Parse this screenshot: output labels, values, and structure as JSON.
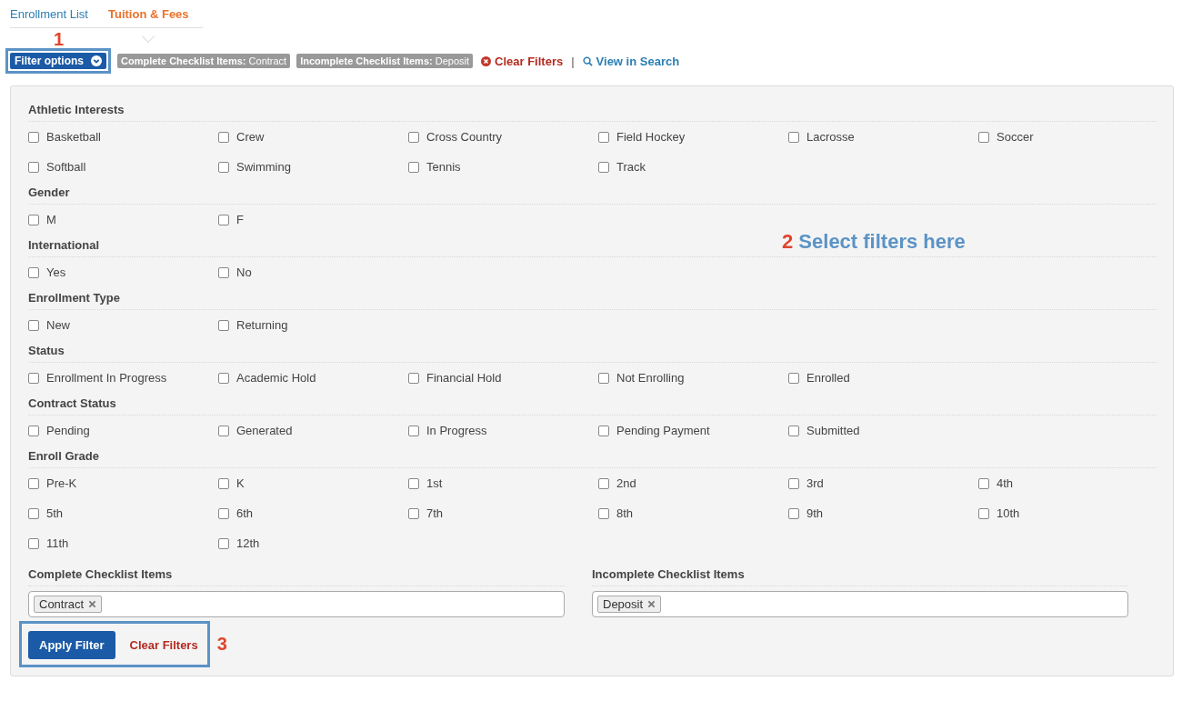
{
  "tabs": [
    {
      "label": "Enrollment List",
      "selected": false
    },
    {
      "label": "Tuition & Fees",
      "selected": true
    }
  ],
  "toolbar": {
    "callout": "1",
    "filter_button": "Filter options",
    "chips": [
      {
        "label": "Complete Checklist Items:",
        "value": "Contract"
      },
      {
        "label": "Incomplete Checklist Items:",
        "value": "Deposit"
      }
    ],
    "clear_filters": "Clear Filters",
    "separator": "|",
    "view_in_search": "View in Search"
  },
  "callout_2": {
    "number": "2",
    "text": "Select filters here"
  },
  "sections": [
    {
      "title": "Athletic Interests",
      "options": [
        {
          "label": "Basketball",
          "checked": false
        },
        {
          "label": "Crew",
          "checked": false
        },
        {
          "label": "Cross Country",
          "checked": false
        },
        {
          "label": "Field Hockey",
          "checked": false
        },
        {
          "label": "Lacrosse",
          "checked": false
        },
        {
          "label": "Soccer",
          "checked": false
        },
        {
          "label": "Softball",
          "checked": false
        },
        {
          "label": "Swimming",
          "checked": false
        },
        {
          "label": "Tennis",
          "checked": false
        },
        {
          "label": "Track",
          "checked": false
        }
      ]
    },
    {
      "title": "Gender",
      "options": [
        {
          "label": "M",
          "checked": false
        },
        {
          "label": "F",
          "checked": false
        }
      ]
    },
    {
      "title": "International",
      "options": [
        {
          "label": "Yes",
          "checked": false
        },
        {
          "label": "No",
          "checked": false
        }
      ]
    },
    {
      "title": "Enrollment Type",
      "options": [
        {
          "label": "New",
          "checked": false
        },
        {
          "label": "Returning",
          "checked": false
        }
      ]
    },
    {
      "title": "Status",
      "options": [
        {
          "label": "Enrollment In Progress",
          "checked": false
        },
        {
          "label": "Academic Hold",
          "checked": false
        },
        {
          "label": "Financial Hold",
          "checked": false
        },
        {
          "label": "Not Enrolling",
          "checked": false
        },
        {
          "label": "Enrolled",
          "checked": false
        }
      ]
    },
    {
      "title": "Contract Status",
      "options": [
        {
          "label": "Pending",
          "checked": false
        },
        {
          "label": "Generated",
          "checked": false
        },
        {
          "label": "In Progress",
          "checked": false
        },
        {
          "label": "Pending Payment",
          "checked": false
        },
        {
          "label": "Submitted",
          "checked": false
        }
      ]
    },
    {
      "title": "Enroll Grade",
      "options": [
        {
          "label": "Pre-K",
          "checked": false
        },
        {
          "label": "K",
          "checked": false
        },
        {
          "label": "1st",
          "checked": false
        },
        {
          "label": "2nd",
          "checked": false
        },
        {
          "label": "3rd",
          "checked": false
        },
        {
          "label": "4th",
          "checked": false
        },
        {
          "label": "5th",
          "checked": false
        },
        {
          "label": "6th",
          "checked": false
        },
        {
          "label": "7th",
          "checked": false
        },
        {
          "label": "8th",
          "checked": false
        },
        {
          "label": "9th",
          "checked": false
        },
        {
          "label": "10th",
          "checked": false
        },
        {
          "label": "11th",
          "checked": false
        },
        {
          "label": "12th",
          "checked": false
        }
      ]
    }
  ],
  "checklist_fields": [
    {
      "title": "Complete Checklist Items",
      "tags": [
        "Contract"
      ]
    },
    {
      "title": "Incomplete Checklist Items",
      "tags": [
        "Deposit"
      ]
    }
  ],
  "actions": {
    "apply": "Apply Filter",
    "clear": "Clear Filters",
    "callout": "3"
  }
}
